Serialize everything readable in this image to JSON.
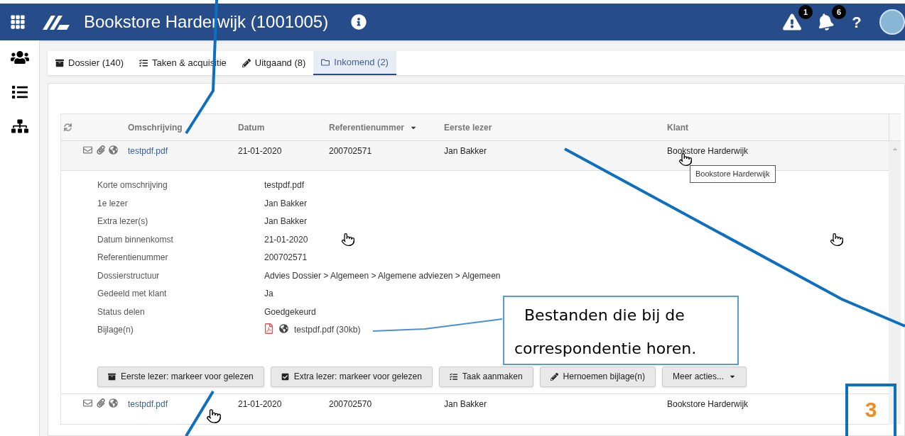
{
  "header": {
    "title": "Bookstore Harderwijk (1001005)",
    "warning_count": "1",
    "notification_count": "6",
    "help": "?"
  },
  "tabs": [
    {
      "label": "Dossier (140)",
      "kind": "archive",
      "selected": false
    },
    {
      "label": "Taken & acquisitie",
      "kind": "tasks",
      "selected": false
    },
    {
      "label": "Uitgaand (8)",
      "kind": "pencil",
      "selected": false
    },
    {
      "label": "Inkomend (2)",
      "kind": "folder",
      "selected": true
    }
  ],
  "table": {
    "columns": [
      {
        "label": "Omschrijving",
        "sorted": false
      },
      {
        "label": "Datum",
        "sorted": false
      },
      {
        "label": "Referentienummer",
        "sorted": true
      },
      {
        "label": "Eerste lezer",
        "sorted": false
      },
      {
        "label": "Klant",
        "sorted": false
      }
    ],
    "rows": [
      {
        "description": "testpdf.pdf",
        "date": "21-01-2020",
        "reference": "200702571",
        "first_reader": "Jan Bakker",
        "client": "Bookstore Harderwijk",
        "expanded": true,
        "details": [
          {
            "label": "Korte omschrijving",
            "value": "testpdf.pdf"
          },
          {
            "label": "1e lezer",
            "value": "Jan Bakker"
          },
          {
            "label": "Extra lezer(s)",
            "value": "Jan Bakker"
          },
          {
            "label": "Datum binnenkomst",
            "value": "21-01-2020"
          },
          {
            "label": "Referentienummer",
            "value": "200702571"
          },
          {
            "label": "Dossierstructuur",
            "value": "Advies Dossier > Algemeen > Algemene adviezen > Algemeen"
          },
          {
            "label": "Gedeeld met klant",
            "value": "Ja"
          },
          {
            "label": "Status delen",
            "value": "Goedgekeurd"
          },
          {
            "label": "Bijlage(n)",
            "value": "testpdf.pdf (30kb)",
            "kind": "attachment"
          }
        ],
        "actions": [
          {
            "label": "Eerste lezer: markeer voor gelezen",
            "kind": "archive"
          },
          {
            "label": "Extra lezer: markeer voor gelezen",
            "kind": "check"
          },
          {
            "label": "Taak aanmaken",
            "kind": "tasks"
          },
          {
            "label": "Hernoemen bijlage(n)",
            "kind": "pencil"
          },
          {
            "label": "Meer acties...",
            "kind": "dropdown"
          }
        ]
      },
      {
        "description": "testpdf.pdf",
        "date": "21-01-2020",
        "reference": "200702570",
        "first_reader": "Jan Bakker",
        "client": "Bookstore Harderwijk",
        "expanded": false
      }
    ]
  },
  "tooltip": "Bookstore Harderwijk",
  "annotations": {
    "callout": "Bestanden die bij de correspondentie horen.",
    "step_number": "3"
  }
}
